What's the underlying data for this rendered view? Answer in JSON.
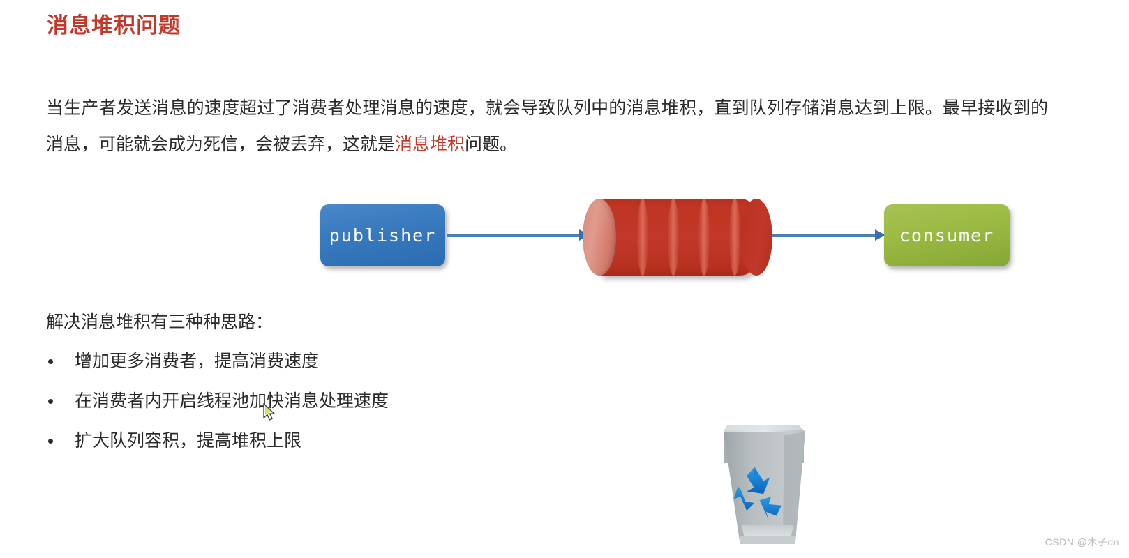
{
  "page": {
    "title": "消息堆积问题",
    "title_color": "#c0392b",
    "background_color": "#ffffff",
    "body_text_color": "#2b2b2b"
  },
  "intro": {
    "segment_1": "当生产者发送消息的速度超过了消费者处理消息的速度，就会导致队列中的消息堆积，直到队列存储消息达到上限。最早接收到的消息，可能就会成为死信，会被丢弃，这就是",
    "highlight": "消息堆积",
    "highlight_color": "#c0392b",
    "segment_2": "问题。"
  },
  "diagram": {
    "publisher": {
      "label": "publisher",
      "color": "#3a7cbf",
      "icon": "rounded-rect-node"
    },
    "queue": {
      "label": "",
      "color": "#c0362a",
      "cap_color": "#de9789",
      "segments": 5,
      "icon": "cylinder-queue"
    },
    "consumer": {
      "label": "consumer",
      "color": "#9cbb44",
      "icon": "rounded-rect-node"
    },
    "arrows": [
      {
        "name": "publisher-to-queue",
        "color": "#4a7fbd"
      },
      {
        "name": "queue-to-consumer",
        "color": "#4a7fbd"
      }
    ]
  },
  "solutions": {
    "heading": "解决消息堆积有三种种思路：",
    "items": [
      "增加更多消费者，提高消费速度",
      "在消费者内开启线程池加快消息处理速度",
      "扩大队列容积，提高堆积上限"
    ]
  },
  "illustration": {
    "name": "recycle-bin",
    "bin_color": "#b7bcbe",
    "recycle_symbol_color": "#1b7fd4",
    "discarded_item_color": "#c0362a"
  },
  "cursor": {
    "name": "mouse-pointer",
    "fill": "#ffffff",
    "accent": "#c7d94a"
  },
  "watermark": {
    "text": "CSDN @木子dn",
    "color": "#b9b9b9"
  }
}
